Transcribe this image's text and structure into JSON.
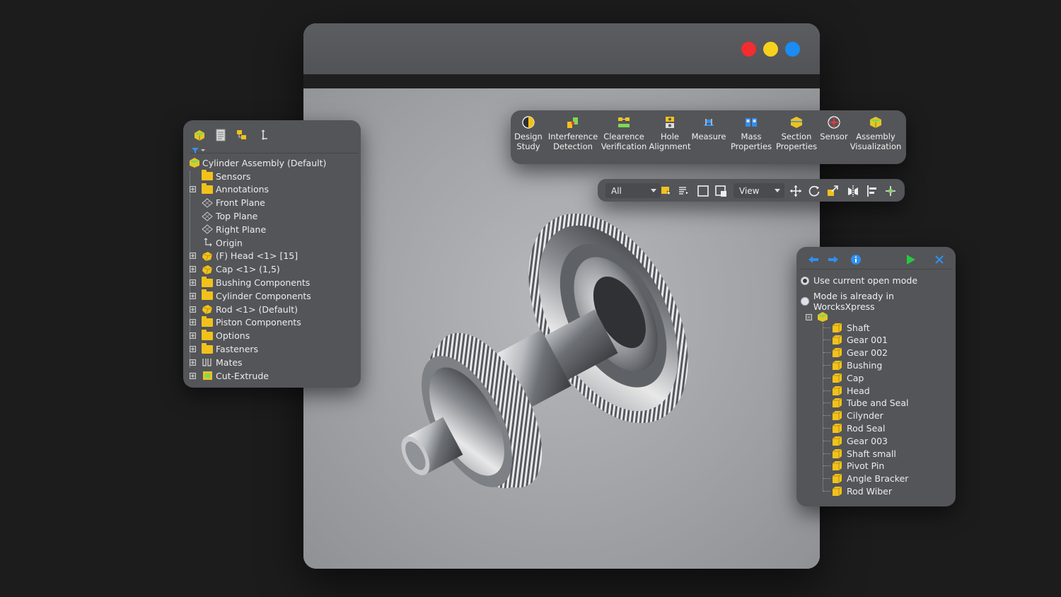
{
  "window": {
    "controls": [
      "close",
      "minimize",
      "maximize"
    ]
  },
  "feature_tree": {
    "tabs": [
      "feature-manager-icon",
      "property-manager-icon",
      "configuration-manager-icon",
      "dimxpert-icon"
    ],
    "root": "Cylinder Assembly (Default)",
    "items": [
      {
        "label": "Sensors",
        "icon": "folder",
        "expandable": false
      },
      {
        "label": "Annotations",
        "icon": "folder",
        "expandable": true
      },
      {
        "label": "Front Plane",
        "icon": "plane",
        "expandable": false
      },
      {
        "label": "Top Plane",
        "icon": "plane",
        "expandable": false
      },
      {
        "label": "Right Plane",
        "icon": "plane",
        "expandable": false
      },
      {
        "label": "Origin",
        "icon": "origin",
        "expandable": false
      },
      {
        "label": "(F) Head <1> [15]",
        "icon": "part",
        "expandable": true
      },
      {
        "label": "Cap <1> (1,5)",
        "icon": "part",
        "expandable": true
      },
      {
        "label": "Bushing Components",
        "icon": "folder",
        "expandable": true
      },
      {
        "label": "Cylinder Components",
        "icon": "folder",
        "expandable": true
      },
      {
        "label": "Rod <1> (Default)",
        "icon": "part",
        "expandable": true
      },
      {
        "label": "Piston Components",
        "icon": "folder",
        "expandable": true
      },
      {
        "label": "Options",
        "icon": "folder",
        "expandable": true
      },
      {
        "label": "Fasteners",
        "icon": "folder",
        "expandable": true
      },
      {
        "label": "Mates",
        "icon": "mates",
        "expandable": true
      },
      {
        "label": "Cut-Extrude",
        "icon": "cut",
        "expandable": true
      }
    ]
  },
  "command_toolbar": {
    "items": [
      {
        "line1": "Design",
        "line2": "Study",
        "icon": "design-study-icon"
      },
      {
        "line1": "Interference",
        "line2": "Detection",
        "icon": "interference-detection-icon"
      },
      {
        "line1": "Clearence",
        "line2": "Verification",
        "icon": "clearance-verification-icon"
      },
      {
        "line1": "Hole",
        "line2": "Alignment",
        "icon": "hole-alignment-icon"
      },
      {
        "line1": "Measure",
        "line2": "",
        "icon": "measure-icon"
      },
      {
        "line1": "Mass",
        "line2": "Properties",
        "icon": "mass-properties-icon"
      },
      {
        "line1": "Section",
        "line2": "Properties",
        "icon": "section-properties-icon"
      },
      {
        "line1": "Sensor",
        "line2": "",
        "icon": "sensor-icon"
      },
      {
        "line1": "Assembly",
        "line2": "Visualization",
        "icon": "assembly-visualization-icon"
      }
    ]
  },
  "view_toolbar": {
    "filter_value": "All",
    "view_value": "View"
  },
  "worksxpress": {
    "options": [
      {
        "label": "Use current open mode",
        "selected": true
      },
      {
        "label": "Mode is already in WorcksXpress",
        "selected": false
      }
    ],
    "items": [
      "Shaft",
      "Gear 001",
      "Gear 002",
      "Bushing",
      "Cap",
      "Head",
      "Tube and Seal",
      "Cilynder",
      "Rod Seal",
      "Gear 003",
      "Shaft small",
      "Pivot Pin",
      "Angle Bracker",
      "Rod Wiber"
    ]
  },
  "colors": {
    "close": "#f12d2f",
    "minimize": "#f7d21c",
    "maximize": "#1a8cf2",
    "folder": "#f2c21b",
    "accent_blue": "#2f8ff0",
    "accent_green": "#27c93f"
  }
}
